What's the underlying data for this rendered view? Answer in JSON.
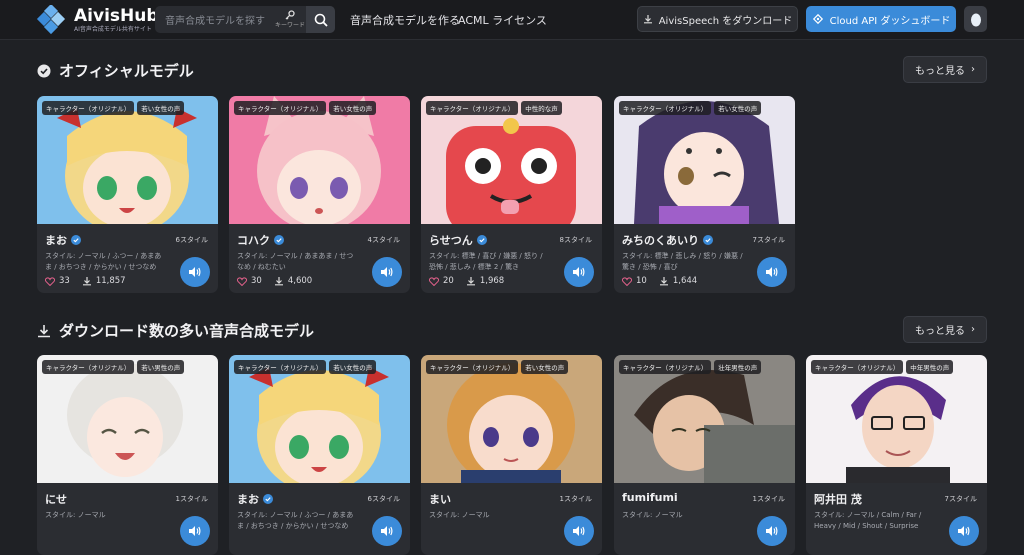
{
  "header": {
    "logo_name": "AivisHub",
    "logo_sub": "AI音声合成モデル共有サイト",
    "search_placeholder": "音声合成モデルを探す",
    "keyword_label": "キーワード",
    "nav_create": "音声合成モデルを作る",
    "nav_license": "ACML ライセンス",
    "download_btn": "AivisSpeech をダウンロード",
    "cloud_btn": "Cloud API ダッシュボード"
  },
  "sections": [
    {
      "title": "オフィシャルモデル",
      "more": "もっと見る"
    },
    {
      "title": "ダウンロード数の多い音声合成モデル",
      "more": "もっと見る"
    }
  ],
  "official_cards": [
    {
      "tag1": "キャラクター（オリジナル）",
      "tag2": "若い女性の声",
      "name": "まお",
      "styles": "6スタイル",
      "style_text": "スタイル: ノーマル / ふつー / あまあま / おちつき / からかい / せつなめ",
      "likes": "33",
      "downloads": "11,857",
      "verified": true
    },
    {
      "tag1": "キャラクター（オリジナル）",
      "tag2": "若い女性の声",
      "name": "コハク",
      "styles": "4スタイル",
      "style_text": "スタイル: ノーマル / あまあま / せつなめ / ねむたい",
      "likes": "30",
      "downloads": "4,600",
      "verified": true
    },
    {
      "tag1": "キャラクター（オリジナル）",
      "tag2": "中性的な声",
      "name": "らせつん",
      "styles": "8スタイル",
      "style_text": "スタイル: 標準 / 喜び / 嫌悪 / 怒り / 恐怖 / 悲しみ / 標準 2 / 驚き",
      "likes": "20",
      "downloads": "1,968",
      "verified": true
    },
    {
      "tag1": "キャラクター（オリジナル）",
      "tag2": "若い女性の声",
      "name": "みちのくあいり",
      "styles": "7スタイル",
      "style_text": "スタイル: 標準 / 悲しみ / 怒り / 嫌悪 / 驚き / 恐怖 / 喜び",
      "likes": "10",
      "downloads": "1,644",
      "verified": true
    }
  ],
  "download_cards": [
    {
      "tag1": "キャラクター（オリジナル）",
      "tag2": "若い男性の声",
      "name": "にせ",
      "styles": "1スタイル",
      "style_text": "スタイル: ノーマル",
      "verified": false
    },
    {
      "tag1": "キャラクター（オリジナル）",
      "tag2": "若い女性の声",
      "name": "まお",
      "styles": "6スタイル",
      "style_text": "スタイル: ノーマル / ふつー / あまあま / おちつき / からかい / せつなめ",
      "verified": true
    },
    {
      "tag1": "キャラクター（オリジナル）",
      "tag2": "若い女性の声",
      "name": "まい",
      "styles": "1スタイル",
      "style_text": "スタイル: ノーマル",
      "verified": false
    },
    {
      "tag1": "キャラクター（オリジナル）",
      "tag2": "壮年男性の声",
      "name": "fumifumi",
      "styles": "1スタイル",
      "style_text": "スタイル: ノーマル",
      "verified": false
    },
    {
      "tag1": "キャラクター（オリジナル）",
      "tag2": "中年男性の声",
      "name": "阿井田 茂",
      "styles": "7スタイル",
      "style_text": "スタイル: ノーマル / Calm / Far / Heavy / Mid / Shout / Surprise",
      "verified": false
    }
  ],
  "colors": {
    "accent": "#3b8bd9",
    "bg": "#1f2125",
    "card": "#2b2d32",
    "like": "#e0608a"
  }
}
